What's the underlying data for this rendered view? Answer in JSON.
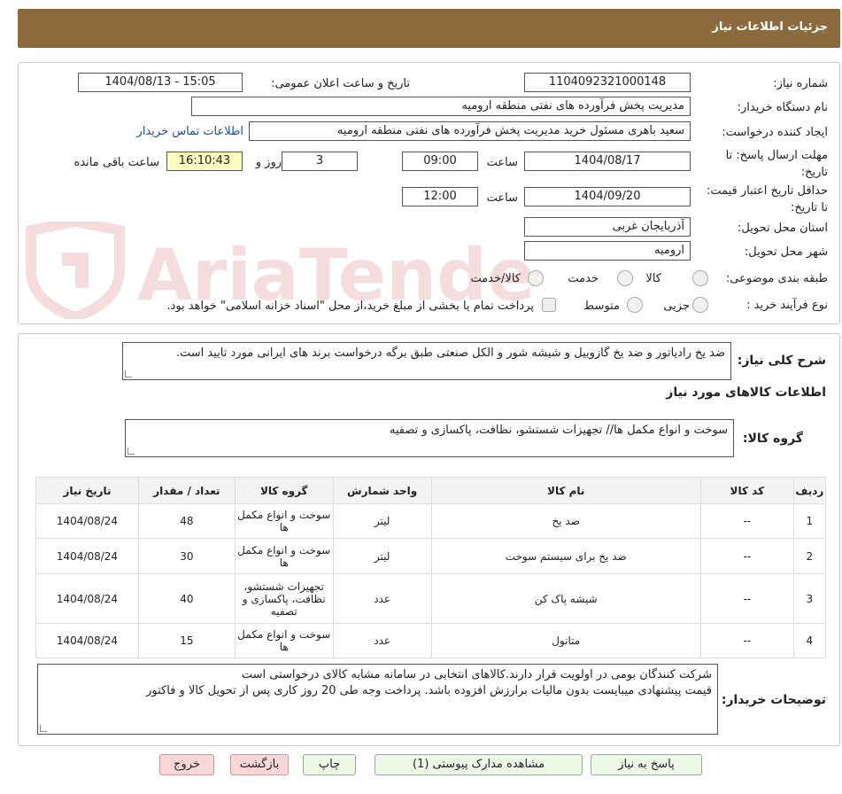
{
  "header": {
    "title": "جزئیات اطلاعات نیاز"
  },
  "form": {
    "need_number_label": "شماره نیاز:",
    "need_number": "1104092321000148",
    "announce_label": "تاریخ و ساعت اعلان عمومی:",
    "announce_value": "1404/08/13 - 15:05",
    "buyer_org_label": "نام دستگاه خریدار:",
    "buyer_org": "مدیریت پخش فرآورده های نفتی منطقه ارومیه",
    "creator_label": "ایجاد کننده درخواست:",
    "creator": "سعید باهری مسئول خرید مدیریت پخش فرآورده های نفتی منطقه ارومیه",
    "contact_link": "اطلاعات تماس خریدار",
    "deadline_label": "مهلت ارسال پاسخ: تا تاریخ:",
    "deadline_date": "1404/08/17",
    "time_label": "ساعت",
    "deadline_time": "09:00",
    "days_value": "3",
    "days_label": "روز و",
    "remaining_time": "16:10:43",
    "remaining_label": "ساعت باقی مانده",
    "validity_label": "حداقل تاریخ اعتبار قیمت: تا تاریخ:",
    "validity_date": "1404/09/20",
    "validity_time": "12:00",
    "province_label": "استان محل تحویل:",
    "province": "آذربایجان غربی",
    "city_label": "شهر محل تحویل:",
    "city": "ارومیه",
    "category_label": "طبقه بندی موضوعی:",
    "category_options": [
      "کالا",
      "خدمت",
      "کالا/خدمت"
    ],
    "process_label": "نوع فرآیند خرید :",
    "process_options": [
      "جزیی",
      "متوسط"
    ],
    "process_note": "پرداخت تمام یا بخشی از مبلغ خرید،از محل \"اسناد خزانه اسلامی\" خواهد بود."
  },
  "watermark": {
    "text": "AriaTender.neT"
  },
  "details": {
    "summary_label": "شرح کلی نیاز:",
    "summary_text": "ضد یخ رادیاتور و ضد یخ گازوییل و شیشه شور و الکل صنعتی طبق برگه درخواست برند های ایرانی مورد تایید است.",
    "items_title": "اطلاعات کالاهای مورد نیاز",
    "group_label": "گروه کالا:",
    "group_text": "سوخت و انواع مکمل ها// تجهیزات شستشو، نظافت، پاکسازی و تصفیه"
  },
  "table": {
    "headers": [
      "ردیف",
      "کد کالا",
      "نام کالا",
      "واحد شمارش",
      "گروه کالا",
      "تعداد / مقدار",
      "تاریخ نیاز"
    ],
    "rows": [
      {
        "row": "1",
        "code": "--",
        "name": "ضد یخ",
        "unit": "لیتر",
        "group": "سوخت و انواع مکمل ها",
        "qty": "48",
        "date": "1404/08/24"
      },
      {
        "row": "2",
        "code": "--",
        "name": "ضد یخ برای سیستم سوخت",
        "unit": "لیتر",
        "group": "سوخت و انواع مکمل ها",
        "qty": "30",
        "date": "1404/08/24"
      },
      {
        "row": "3",
        "code": "--",
        "name": "شیشه پاک کن",
        "unit": "عدد",
        "group": "تجهیزات شستشو، نظافت، پاکسازی و تصفیه",
        "qty": "40",
        "date": "1404/08/24"
      },
      {
        "row": "4",
        "code": "--",
        "name": "متانول",
        "unit": "عدد",
        "group": "سوخت و انواع مکمل ها",
        "qty": "15",
        "date": "1404/08/24"
      }
    ]
  },
  "buyer_notes": {
    "label": "توضیحات خریدار:",
    "line1": "شرکت کنندگان بومی در اولویت قرار دارند.کالاهای انتخابی در سامانه مشابه کالای درخواستی است",
    "line2": "قیمت پیشنهادی میبایست بدون مالیات برارزش افزوده باشد. پرداخت وجه طی 20 روز کاری پس از تحویل کالا و فاکتور"
  },
  "buttons": {
    "reply": "پاسخ به نیاز",
    "attachments": "مشاهده مدارک پیوستی (1)",
    "print": "چاپ",
    "back": "بازگشت",
    "exit": "خروج"
  }
}
